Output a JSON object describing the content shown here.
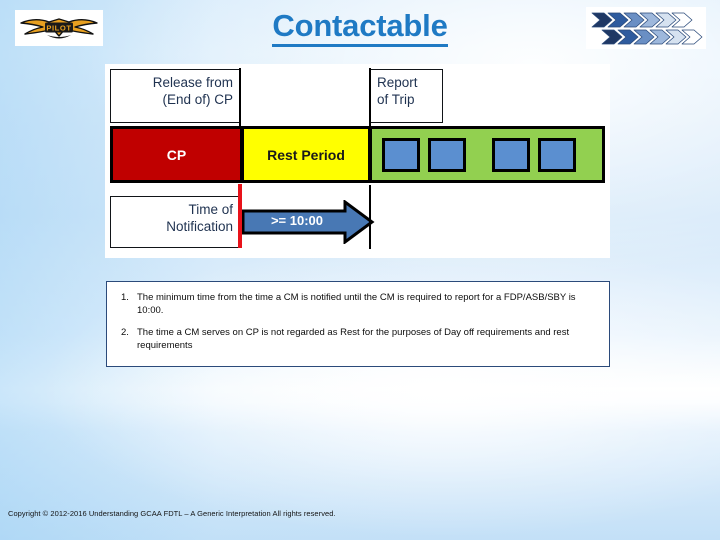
{
  "slide": {
    "title": "Contactable",
    "title_color": "#1F7AC4",
    "background_colors": [
      "#DCEDFB",
      "#FFFFFF",
      "#C3E0F7"
    ]
  },
  "logos": {
    "left": {
      "name": "pilot-wings-badge",
      "text": "PILOT",
      "colors": [
        "#E8A020",
        "#1A1A1A"
      ]
    },
    "right": {
      "name": "chevron-arrows-logo",
      "rows": 2,
      "chevrons_per_row": 6,
      "colors": [
        "#1F3864",
        "#2E5B9E",
        "#6A8FC4",
        "#9EB8DC",
        "#C9D8EC",
        "#FFFFFF"
      ]
    }
  },
  "diagram": {
    "labels": {
      "release": {
        "line1": "Release from",
        "line2": "(End of) CP"
      },
      "report": {
        "line1": "Report",
        "line2": "of Trip"
      },
      "notification": {
        "line1": "Time of",
        "line2": "Notification"
      }
    },
    "timeline": [
      {
        "id": "cp",
        "label": "CP",
        "color": "#C00000",
        "text_color": "#FFFFFF"
      },
      {
        "id": "rest",
        "label": "Rest Period",
        "color": "#FFFF00",
        "text_color": "#1A1A1A"
      },
      {
        "id": "fdp",
        "label": "",
        "color": "#92D050",
        "text_color": "#000000",
        "sectors": 4,
        "sector_color": "#5B8FD0"
      }
    ],
    "arrow": {
      "label": ">= 10:00",
      "fill": "#4878B4",
      "outline": "#000000",
      "text_color": "#FFFFFF"
    },
    "marker_color": "#E8121A"
  },
  "notes": [
    {
      "number": "1.",
      "text": "The minimum time from the time a CM is notified until the CM is required to report for a FDP/ASB/SBY is 10:00."
    },
    {
      "number": "2.",
      "text": "The time a CM serves on CP is not regarded as Rest for the purposes of Day off requirements and rest requirements"
    }
  ],
  "footer": {
    "copyright": "Copyright © 2012-2016 Understanding GCAA FDTL – A Generic Interpretation All rights reserved."
  }
}
